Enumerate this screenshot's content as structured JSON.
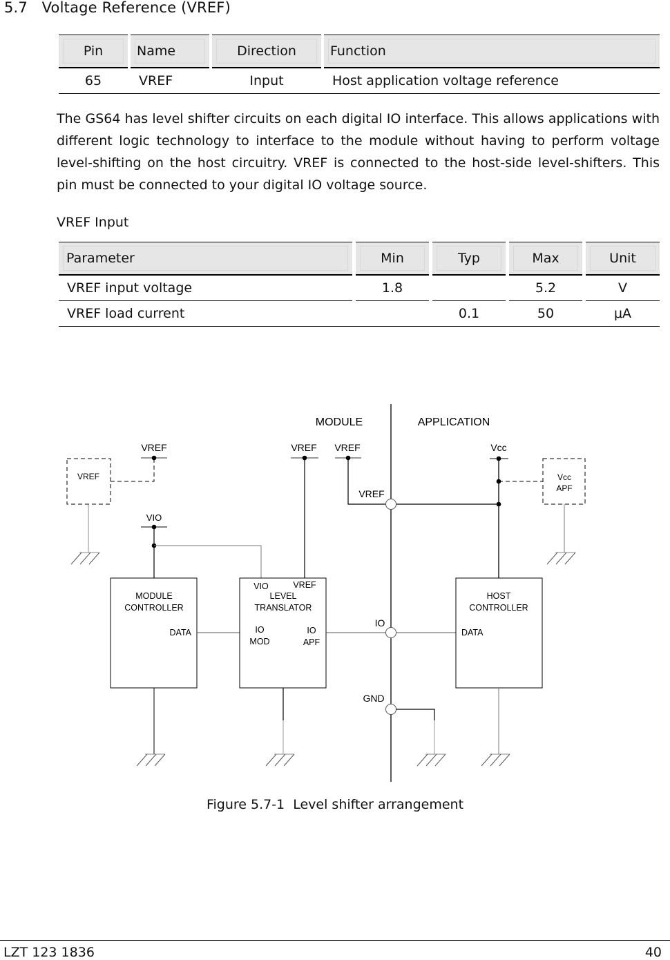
{
  "section": {
    "number": "5.7",
    "title": "Voltage Reference (VREF)",
    "full": "5.7   Voltage Reference (VREF)"
  },
  "pin_table": {
    "headers": [
      "Pin",
      "Name",
      "Direction",
      "Function"
    ],
    "rows": [
      {
        "pin": "65",
        "name": "VREF",
        "direction": "Input",
        "function": "Host application  voltage reference"
      }
    ]
  },
  "body": {
    "paragraph": "The GS64 has level shifter circuits on each digital IO interface.  This allows applications with different logic technology to interface to the module without having to perform voltage level-shifting on the host circuitry.  VREF is connected to the host-side level-shifters.  This pin must be connected to your digital IO voltage source."
  },
  "vref_input": {
    "label": "VREF Input",
    "headers": [
      "Parameter",
      "Min",
      "Typ",
      "Max",
      "Unit"
    ],
    "rows": [
      {
        "parameter": "VREF input voltage",
        "min": "1.8",
        "typ": "",
        "max": "5.2",
        "unit": "V"
      },
      {
        "parameter": "VREF load current",
        "min": "",
        "typ": "0.1",
        "max": "50",
        "unit": "μA"
      }
    ]
  },
  "diagram": {
    "region_labels": {
      "module": "MODULE",
      "application": "APPLICATION"
    },
    "rail_labels": {
      "vref_left": "VREF",
      "vref_mid1": "VREF",
      "vref_mid2": "VREF",
      "vcc": "Vcc",
      "vio": "VIO",
      "vref_node": "VREF",
      "io_node": "IO",
      "gnd_node": "GND"
    },
    "optional_blocks": {
      "vref_source": "VREF",
      "vcc_apf_line1": "Vcc",
      "vcc_apf_line2": "APF"
    },
    "blocks": {
      "module_controller": {
        "line1": "MODULE",
        "line2": "CONTROLLER",
        "port": "DATA"
      },
      "level_translator": {
        "line1": "LEVEL",
        "line2": "TRANSLATOR",
        "vio": "VIO",
        "vref": "VREF",
        "io_mod_1": "IO",
        "io_mod_2": "MOD",
        "io_apf_1": "IO",
        "io_apf_2": "APF"
      },
      "host_controller": {
        "line1": "HOST",
        "line2": "CONTROLLER",
        "port": "DATA"
      }
    }
  },
  "figure": {
    "caption": "Figure 5.7-1  Level shifter arrangement"
  },
  "footer": {
    "doc_number": "LZT 123 1836",
    "page": "40"
  }
}
